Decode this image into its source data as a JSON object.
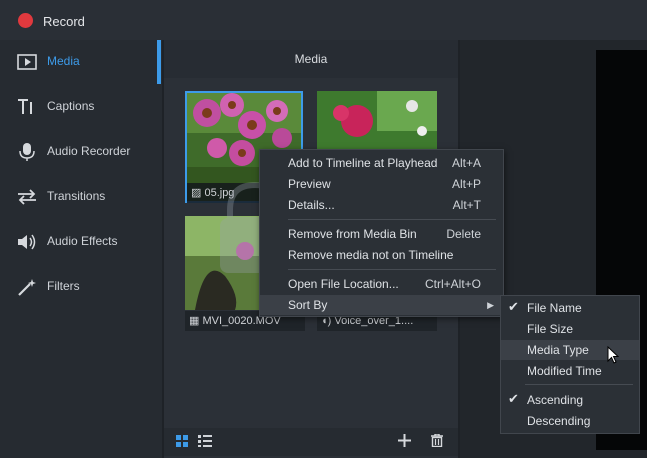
{
  "title_bar": {
    "record_label": "Record"
  },
  "sidebar": {
    "items": [
      {
        "label": "Media",
        "icon": "media-icon",
        "active": true
      },
      {
        "label": "Captions",
        "icon": "captions-icon"
      },
      {
        "label": "Audio Recorder",
        "icon": "microphone-icon"
      },
      {
        "label": "Transitions",
        "icon": "transitions-icon"
      },
      {
        "label": "Audio Effects",
        "icon": "speaker-icon"
      },
      {
        "label": "Filters",
        "icon": "magic-wand-icon"
      }
    ]
  },
  "media_panel": {
    "title": "Media",
    "items": [
      {
        "name": "05.jpg",
        "type": "image",
        "selected": true
      },
      {
        "name": "",
        "type": "image"
      },
      {
        "name": "MVI_0020.MOV",
        "type": "video"
      },
      {
        "name": "Voice_over_1....",
        "type": "audio"
      }
    ]
  },
  "context_menu": {
    "items": [
      {
        "label": "Add to Timeline at Playhead",
        "shortcut": "Alt+A"
      },
      {
        "label": "Preview",
        "shortcut": "Alt+P"
      },
      {
        "label": "Details...",
        "shortcut": "Alt+T"
      },
      {
        "label": "Remove from Media Bin",
        "shortcut": "Delete"
      },
      {
        "label": "Remove media not on Timeline",
        "shortcut": ""
      },
      {
        "label": "Open File Location...",
        "shortcut": "Ctrl+Alt+O"
      },
      {
        "label": "Sort By",
        "shortcut": "▶"
      }
    ]
  },
  "sort_submenu": {
    "items": [
      {
        "label": "File Name",
        "checked": true
      },
      {
        "label": "File Size",
        "checked": false
      },
      {
        "label": "Media Type",
        "checked": false,
        "hover": true
      },
      {
        "label": "Modified Time",
        "checked": false
      },
      {
        "label": "Ascending",
        "checked": true
      },
      {
        "label": "Descending",
        "checked": false
      }
    ],
    "check_glyph": "✔"
  },
  "colors": {
    "accent": "#3d9be9",
    "record": "#e0393e"
  }
}
